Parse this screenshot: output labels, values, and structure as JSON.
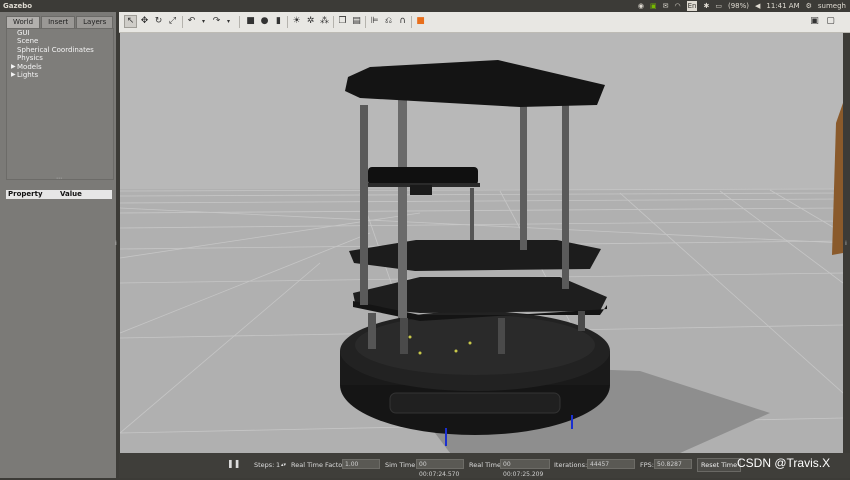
{
  "app": {
    "title": "Gazebo"
  },
  "system_tray": {
    "battery": "(98%)",
    "time": "11:41 AM",
    "user": "sumegh",
    "icons": [
      "gazebo-tray-icon",
      "nvidia-icon",
      "mail-icon",
      "wifi-icon",
      "keyboard-layout-icon",
      "bluetooth-icon",
      "battery-icon",
      "volume-icon",
      "settings-gear-icon"
    ]
  },
  "left_panel": {
    "tabs": [
      "World",
      "Insert",
      "Layers"
    ],
    "tree_items": [
      {
        "label": "GUI",
        "expandable": false
      },
      {
        "label": "Scene",
        "expandable": false
      },
      {
        "label": "Spherical Coordinates",
        "expandable": false
      },
      {
        "label": "Physics",
        "expandable": false
      },
      {
        "label": "Models",
        "expandable": true
      },
      {
        "label": "Lights",
        "expandable": true
      }
    ],
    "property_header": {
      "property": "Property",
      "value": "Value"
    }
  },
  "toolbar": {
    "tools": [
      "select-arrow-icon",
      "translate-icon",
      "rotate-icon",
      "scale-icon",
      "undo-icon",
      "undo-history-icon",
      "redo-icon",
      "redo-history-icon",
      "box-icon",
      "sphere-icon",
      "cylinder-icon",
      "point-light-icon",
      "spot-light-icon",
      "directional-light-icon",
      "copy-icon",
      "paste-icon",
      "align-icon",
      "snap-icon",
      "magnet-icon",
      "record-icon"
    ],
    "right_tools": [
      "screenshot-icon",
      "record-video-icon"
    ]
  },
  "bottom_bar": {
    "steps_label": "Steps:",
    "steps_value": "1",
    "rtf_label": "Real Time Factor:",
    "rtf_value": "1.00",
    "sim_time_label": "Sim Time:",
    "sim_time_value": "00 00:07:24.570",
    "real_time_label": "Real Time:",
    "real_time_value": "00 00:07:25.209",
    "iterations_label": "Iterations:",
    "iterations_value": "44457",
    "fps_label": "FPS:",
    "fps_value": "50.8287",
    "reset_label": "Reset Time"
  },
  "watermark": "CSDN @Travis.X",
  "colors": {
    "accent": "#e86f1c",
    "viewport_bg": "#b8b8b8",
    "panel_bg": "#7b7a77"
  }
}
